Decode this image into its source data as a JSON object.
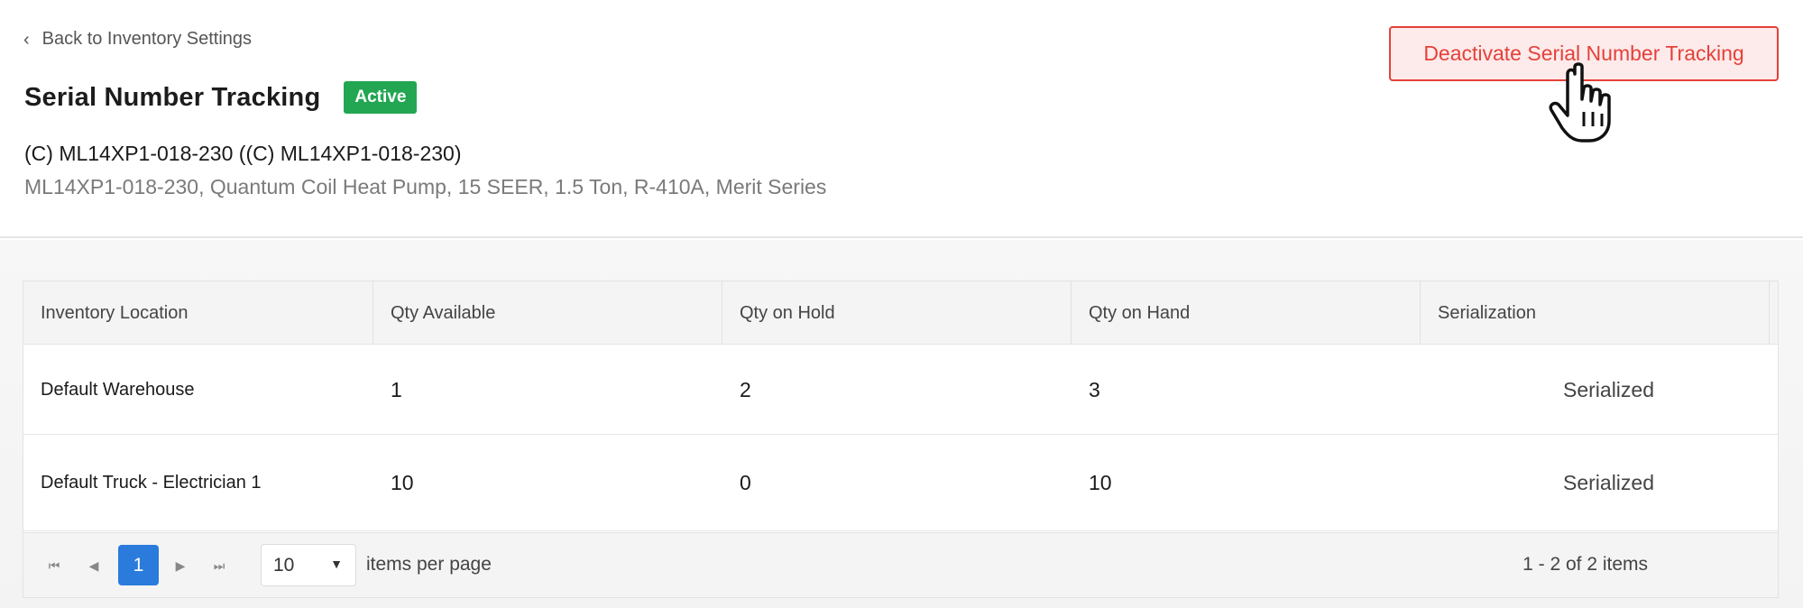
{
  "header": {
    "back_label": "Back to Inventory Settings",
    "title": "Serial Number Tracking",
    "status_badge": "Active",
    "item_code": "(C) ML14XP1-018-230 ((C) ML14XP1-018-230)",
    "item_description": "ML14XP1-018-230, Quantum Coil Heat Pump, 15 SEER, 1.5 Ton, R-410A, Merit Series",
    "deactivate_label": "Deactivate Serial Number Tracking"
  },
  "table": {
    "columns": [
      "Inventory Location",
      "Qty Available",
      "Qty on Hold",
      "Qty on Hand",
      "Serialization"
    ],
    "rows": [
      {
        "location": "Default Warehouse",
        "available": "1",
        "hold": "2",
        "hand": "3",
        "serialization": "Serialized"
      },
      {
        "location": "Default Truck - Electrician 1",
        "available": "10",
        "hold": "0",
        "hand": "10",
        "serialization": "Serialized"
      }
    ]
  },
  "pager": {
    "current_page": "1",
    "page_size": "10",
    "per_page_label": "items per page",
    "range": "1 - 2 of 2 items"
  },
  "icons": {
    "back": "chevron-left-icon",
    "cursor": "pointer-hand-icon",
    "first": "first-page-icon",
    "prev": "prev-page-icon",
    "next": "next-page-icon",
    "last": "last-page-icon"
  },
  "colors": {
    "active_badge": "#22a652",
    "danger": "#e4413a",
    "primary": "#2a7bdb"
  }
}
